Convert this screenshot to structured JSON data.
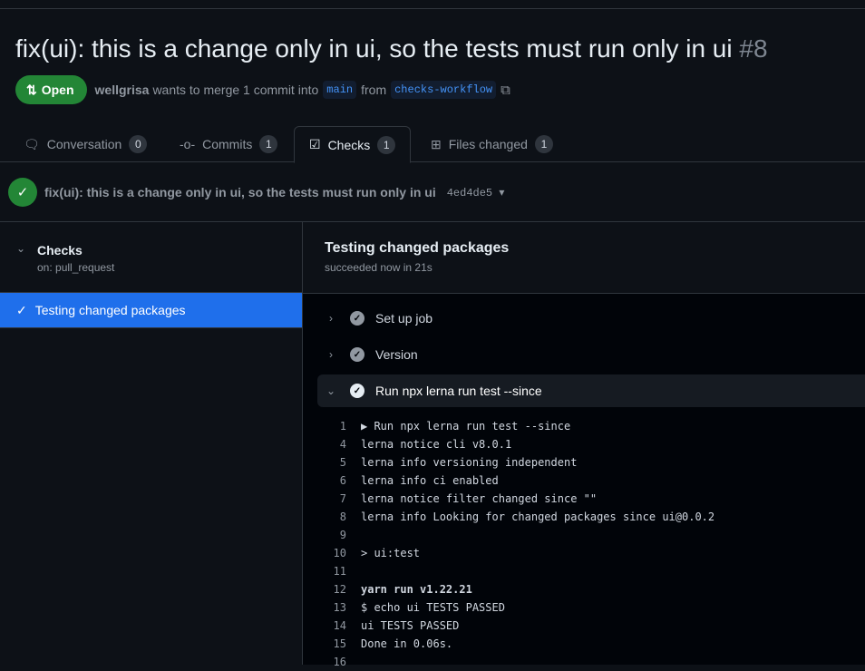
{
  "pr": {
    "title": "fix(ui): this is a change only in ui, so the tests must run only in ui",
    "number": "#8",
    "status": "Open",
    "author": "wellgrisa",
    "merge_text": "wants to merge 1 commit into",
    "base": "main",
    "from": "from",
    "head": "checks-workflow"
  },
  "tabs": [
    {
      "label": "Conversation",
      "count": "0"
    },
    {
      "label": "Commits",
      "count": "1"
    },
    {
      "label": "Checks",
      "count": "1"
    },
    {
      "label": "Files changed",
      "count": "1"
    }
  ],
  "commit": {
    "message": "fix(ui): this is a change only in ui, so the tests must run only in ui",
    "sha": "4ed4de5"
  },
  "sidebar": {
    "workflow": "Checks",
    "trigger": "on: pull_request",
    "job": "Testing changed packages"
  },
  "job": {
    "title": "Testing changed packages",
    "status": "succeeded now in 21s",
    "steps": [
      {
        "label": "Set up job"
      },
      {
        "label": "Version"
      },
      {
        "label": "Run npx lerna run test --since"
      }
    ]
  },
  "log": [
    {
      "n": "1",
      "t": "▶ Run npx lerna run test --since"
    },
    {
      "n": "4",
      "t": "lerna notice cli v8.0.1"
    },
    {
      "n": "5",
      "t": "lerna info versioning independent"
    },
    {
      "n": "6",
      "t": "lerna info ci enabled"
    },
    {
      "n": "7",
      "t": "lerna notice filter changed since \"\""
    },
    {
      "n": "8",
      "t": "lerna info Looking for changed packages since ui@0.0.2"
    },
    {
      "n": "9",
      "t": ""
    },
    {
      "n": "10",
      "t": "> ui:test"
    },
    {
      "n": "11",
      "t": ""
    },
    {
      "n": "12",
      "t": "yarn run v1.22.21",
      "bold": true
    },
    {
      "n": "13",
      "t": "$ echo ui TESTS PASSED"
    },
    {
      "n": "14",
      "t": "ui TESTS PASSED"
    },
    {
      "n": "15",
      "t": "Done in 0.06s."
    },
    {
      "n": "16",
      "t": ""
    }
  ]
}
